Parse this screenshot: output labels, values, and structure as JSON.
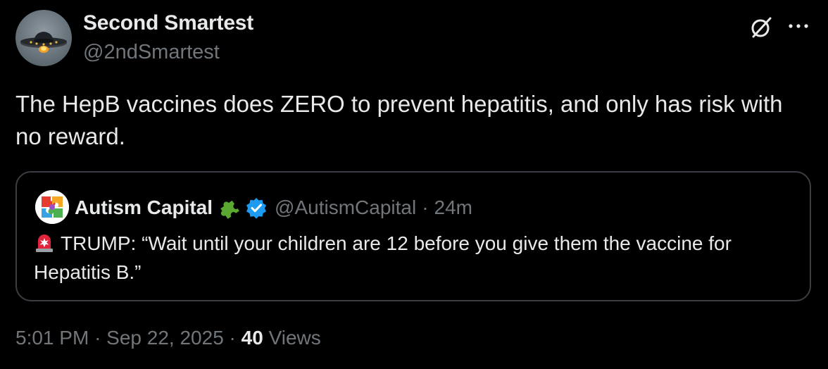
{
  "post": {
    "author": {
      "display_name": "Second Smartest",
      "handle": "@2ndSmartest",
      "avatar_icon": "ufo-avatar"
    },
    "text": "The HepB vaccines does ZERO to prevent hepatitis, and only has risk with no reward.",
    "actions": {
      "grok_icon": "grok-icon",
      "more_icon": "more-options-icon"
    },
    "meta": {
      "time": "5:01 PM",
      "separator": "·",
      "date": "Sep 22, 2025",
      "views_count": "40",
      "views_label": "Views"
    }
  },
  "quote": {
    "author": {
      "display_name": "Autism Capital",
      "handle": "@AutismCapital",
      "avatar_icon": "rainbow-puzzle-avatar",
      "badge_icon": "puzzle-piece-icon",
      "verified_icon": "verified-badge-icon"
    },
    "separator": "·",
    "time_ago": "24m",
    "siren_icon": "police-light-icon",
    "text": "TRUMP: “Wait until your children are 12 before you give them the vaccine for Hepatitis B.”"
  },
  "colors": {
    "background": "#000000",
    "primary_text": "#e7e9ea",
    "secondary_text": "#71767b",
    "card_border": "#3a3e42",
    "verified_blue": "#1d9bf0",
    "puzzle_green": "#5aa832",
    "siren_red": "#e0243b"
  }
}
